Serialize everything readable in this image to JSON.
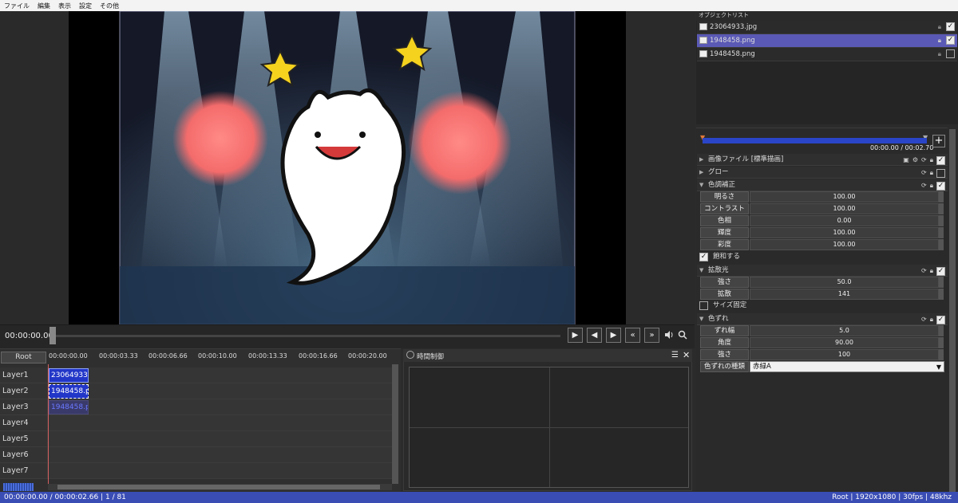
{
  "menu": [
    "ファイル",
    "編集",
    "表示",
    "設定",
    "その他"
  ],
  "preview": {
    "timecode": "00:00:00.00"
  },
  "playback": {
    "play": "▶",
    "prev_frame": "◀",
    "next_frame": "▶",
    "rewind": "«",
    "forward": "»",
    "volume_icon": "speaker-icon",
    "zoom_icon": "zoom-icon"
  },
  "timeline": {
    "root_label": "Root",
    "ticks": [
      "00:00:00.00",
      "00:00:03.33",
      "00:00:06.66",
      "00:00:10.00",
      "00:00:13.33",
      "00:00:16.66",
      "00:00:20.00"
    ],
    "layers": [
      "Layer1",
      "Layer2",
      "Layer3",
      "Layer4",
      "Layer5",
      "Layer6",
      "Layer7"
    ],
    "clips": [
      {
        "layer": 0,
        "label": "23064933.jpg"
      },
      {
        "layer": 1,
        "label": "1948458.png"
      },
      {
        "layer": 2,
        "label": "1948458.png"
      }
    ]
  },
  "time_control": {
    "title": "時間制御",
    "menu_icon": "list-icon",
    "close_icon": "close-icon"
  },
  "object_list": {
    "title": "オブジェクトリスト",
    "items": [
      {
        "name": "23064933.jpg",
        "selected": false,
        "visible": true
      },
      {
        "name": "1948458.png",
        "selected": true,
        "visible": true
      },
      {
        "name": "1948458.png",
        "selected": false,
        "visible": false
      }
    ]
  },
  "properties": {
    "add_label": "+",
    "time": "00:00.00 / 00:02.70",
    "sections": {
      "image_file": "画像ファイル [標準描画]",
      "glow": "グロー",
      "color_correction": "色調補正",
      "diffusion": "拡散光",
      "color_shift": "色ずれ"
    },
    "color_correction_params": [
      {
        "label": "明るさ",
        "value": "100.00"
      },
      {
        "label": "コントラスト",
        "value": "100.00"
      },
      {
        "label": "色相",
        "value": "0.00"
      },
      {
        "label": "輝度",
        "value": "100.00"
      },
      {
        "label": "彩度",
        "value": "100.00"
      }
    ],
    "saturate_label": "飽和する",
    "diffusion_params": [
      {
        "label": "強さ",
        "value": "50.0"
      },
      {
        "label": "拡散",
        "value": "141"
      }
    ],
    "size_fixed_label": "サイズ固定",
    "color_shift_params": [
      {
        "label": "ずれ幅",
        "value": "5.0"
      },
      {
        "label": "角度",
        "value": "90.00"
      },
      {
        "label": "強さ",
        "value": "100"
      }
    ],
    "shift_type_label": "色ずれの種類",
    "shift_type_value": "赤緑A"
  },
  "status": {
    "left": "00:00:00.00 / 00:00:02.66  |  1 / 81",
    "right": "Root  |  1920x1080  |  30fps  |  48khz"
  }
}
